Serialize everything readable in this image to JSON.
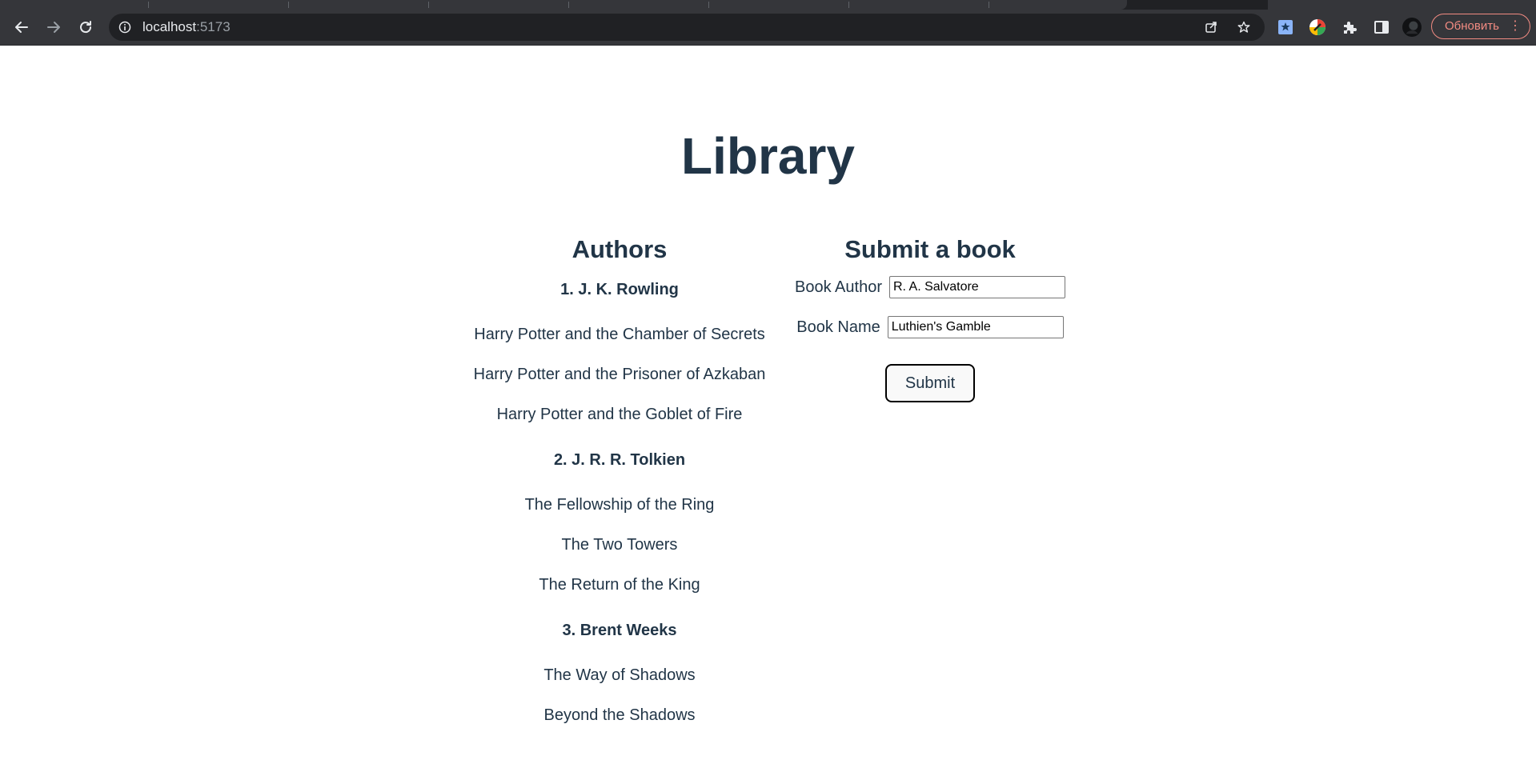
{
  "browser": {
    "url_host": "localhost",
    "url_port": ":5173",
    "update_label": "Обновить"
  },
  "page": {
    "title": "Library",
    "authors_heading": "Authors",
    "authors": [
      {
        "name": "1. J. K. Rowling",
        "books": [
          "Harry Potter and the Chamber of Secrets",
          "Harry Potter and the Prisoner of Azkaban",
          "Harry Potter and the Goblet of Fire"
        ]
      },
      {
        "name": "2. J. R. R. Tolkien",
        "books": [
          "The Fellowship of the Ring",
          "The Two Towers",
          "The Return of the King"
        ]
      },
      {
        "name": "3. Brent Weeks",
        "books": [
          "The Way of Shadows",
          "Beyond the Shadows"
        ]
      }
    ],
    "form": {
      "heading": "Submit a book",
      "author_label": "Book Author",
      "author_value": "R. A. Salvatore",
      "name_label": "Book Name",
      "name_value": "Luthien's Gamble",
      "submit_label": "Submit"
    }
  },
  "colors": {
    "text": "#213547",
    "chrome_bg": "#35363a",
    "omnibox_bg": "#202124",
    "update_accent": "#f28b82"
  },
  "icons": [
    "back-icon",
    "forward-icon",
    "reload-icon",
    "info-icon",
    "share-icon",
    "star-icon",
    "extension-bookmark-icon",
    "extension-color-icon",
    "puzzle-icon",
    "sidepanel-icon",
    "avatar",
    "menu-dots-icon"
  ]
}
